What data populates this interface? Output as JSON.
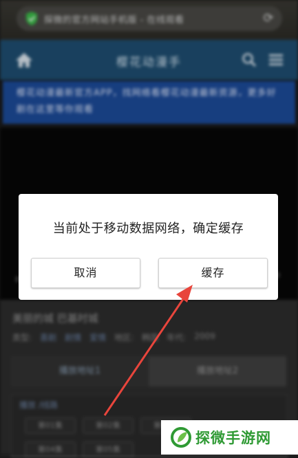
{
  "browser": {
    "url_text": "探微的官方网站手机版 - 在线观看",
    "refresh_icon": "refresh-icon",
    "shield_color": "#3cbf4a"
  },
  "site": {
    "title": "樱花动漫手",
    "banner": "樱花动漫最新官方APP，找网络看樱花动漫最新资源，更多好剧在这里等你观看"
  },
  "video": {
    "time_left": "0",
    "time_right": "0"
  },
  "page": {
    "movie_title": "美丽的城 巴基时城",
    "meta": [
      "类型:",
      "喜剧",
      "剧情",
      "爱情",
      "地区:",
      "韩国",
      "年代:",
      "2009"
    ],
    "tabs": [
      "播放地址1",
      "播放地址2"
    ],
    "episode_header": "播放 /线路",
    "episodes": [
      "第01集",
      "第02集",
      "第03集",
      "第04集",
      "第05集"
    ]
  },
  "dialog": {
    "message": "当前处于移动数据网络，确定缓存",
    "cancel_label": "取消",
    "confirm_label": "缓存"
  },
  "watermark": {
    "text": "探微手游网",
    "color": "#2f9a34"
  },
  "colors": {
    "header_bg": "#1f4f73",
    "banner_bg": "#1d4c9c",
    "arrow": "#e8453c"
  }
}
